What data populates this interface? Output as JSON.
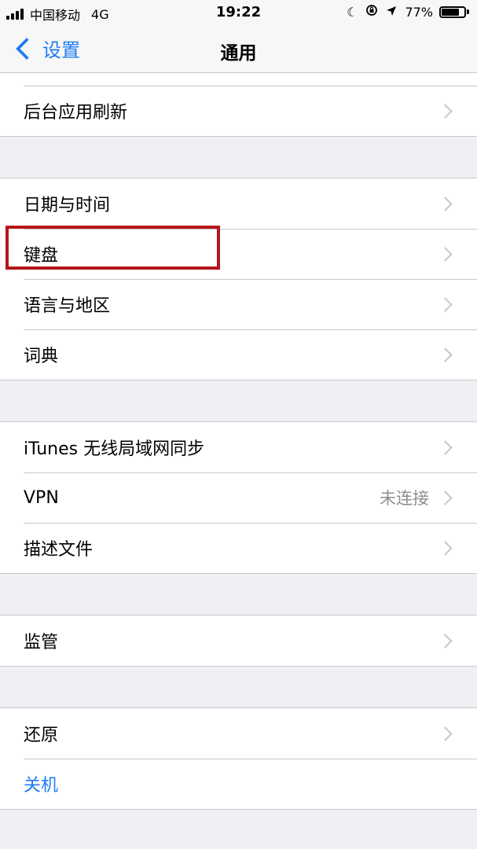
{
  "status_bar": {
    "carrier": "中国移动",
    "network": "4G",
    "time": "19:22",
    "battery_percent": "77%",
    "battery_level": 0.77,
    "icons": [
      "moon-icon",
      "rotation-lock-icon",
      "location-arrow-icon",
      "battery-icon"
    ]
  },
  "nav": {
    "back_label": "设置",
    "title": "通用"
  },
  "groups": [
    {
      "rows": [
        {
          "label": "后台应用刷新"
        }
      ]
    },
    {
      "rows": [
        {
          "label": "日期与时间"
        },
        {
          "label": "键盘"
        },
        {
          "label": "语言与地区"
        },
        {
          "label": "词典"
        }
      ]
    },
    {
      "rows": [
        {
          "label": "iTunes 无线局域网同步"
        },
        {
          "label": "VPN",
          "value": "未连接"
        },
        {
          "label": "描述文件"
        }
      ]
    },
    {
      "rows": [
        {
          "label": "监管"
        }
      ]
    },
    {
      "rows": [
        {
          "label": "还原"
        },
        {
          "label": "关机"
        }
      ]
    }
  ],
  "colors": {
    "accent": "#1f7cf6",
    "highlight": "#b5161a",
    "background": "#efeff4"
  }
}
